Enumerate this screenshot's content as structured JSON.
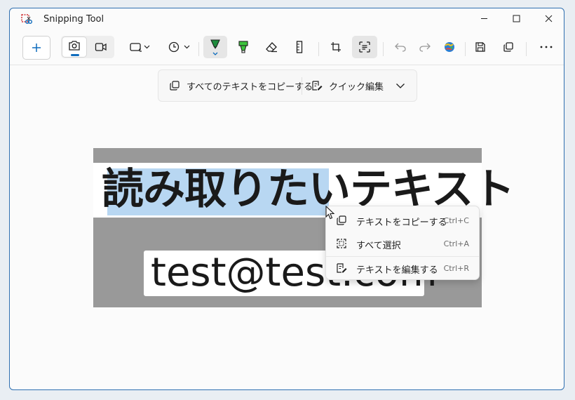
{
  "window": {
    "title": "Snipping Tool"
  },
  "text_actions": {
    "copy_all_label": "すべてのテキストをコピーする",
    "quick_edit_label": "クイック編集"
  },
  "image": {
    "headline": "読み取りたいテキスト",
    "email": "test@test.com"
  },
  "context_menu": {
    "items": [
      {
        "label": "テキストをコピーする",
        "shortcut": "Ctrl+C"
      },
      {
        "label": "すべて選択",
        "shortcut": "Ctrl+A"
      },
      {
        "label": "テキストを編集する",
        "shortcut": "Ctrl+R"
      }
    ]
  },
  "colors": {
    "accent": "#0f6cbd",
    "highlight": "#b8d7f2",
    "pen": "#1e8a3c",
    "highlighter": "#3cc43c"
  }
}
